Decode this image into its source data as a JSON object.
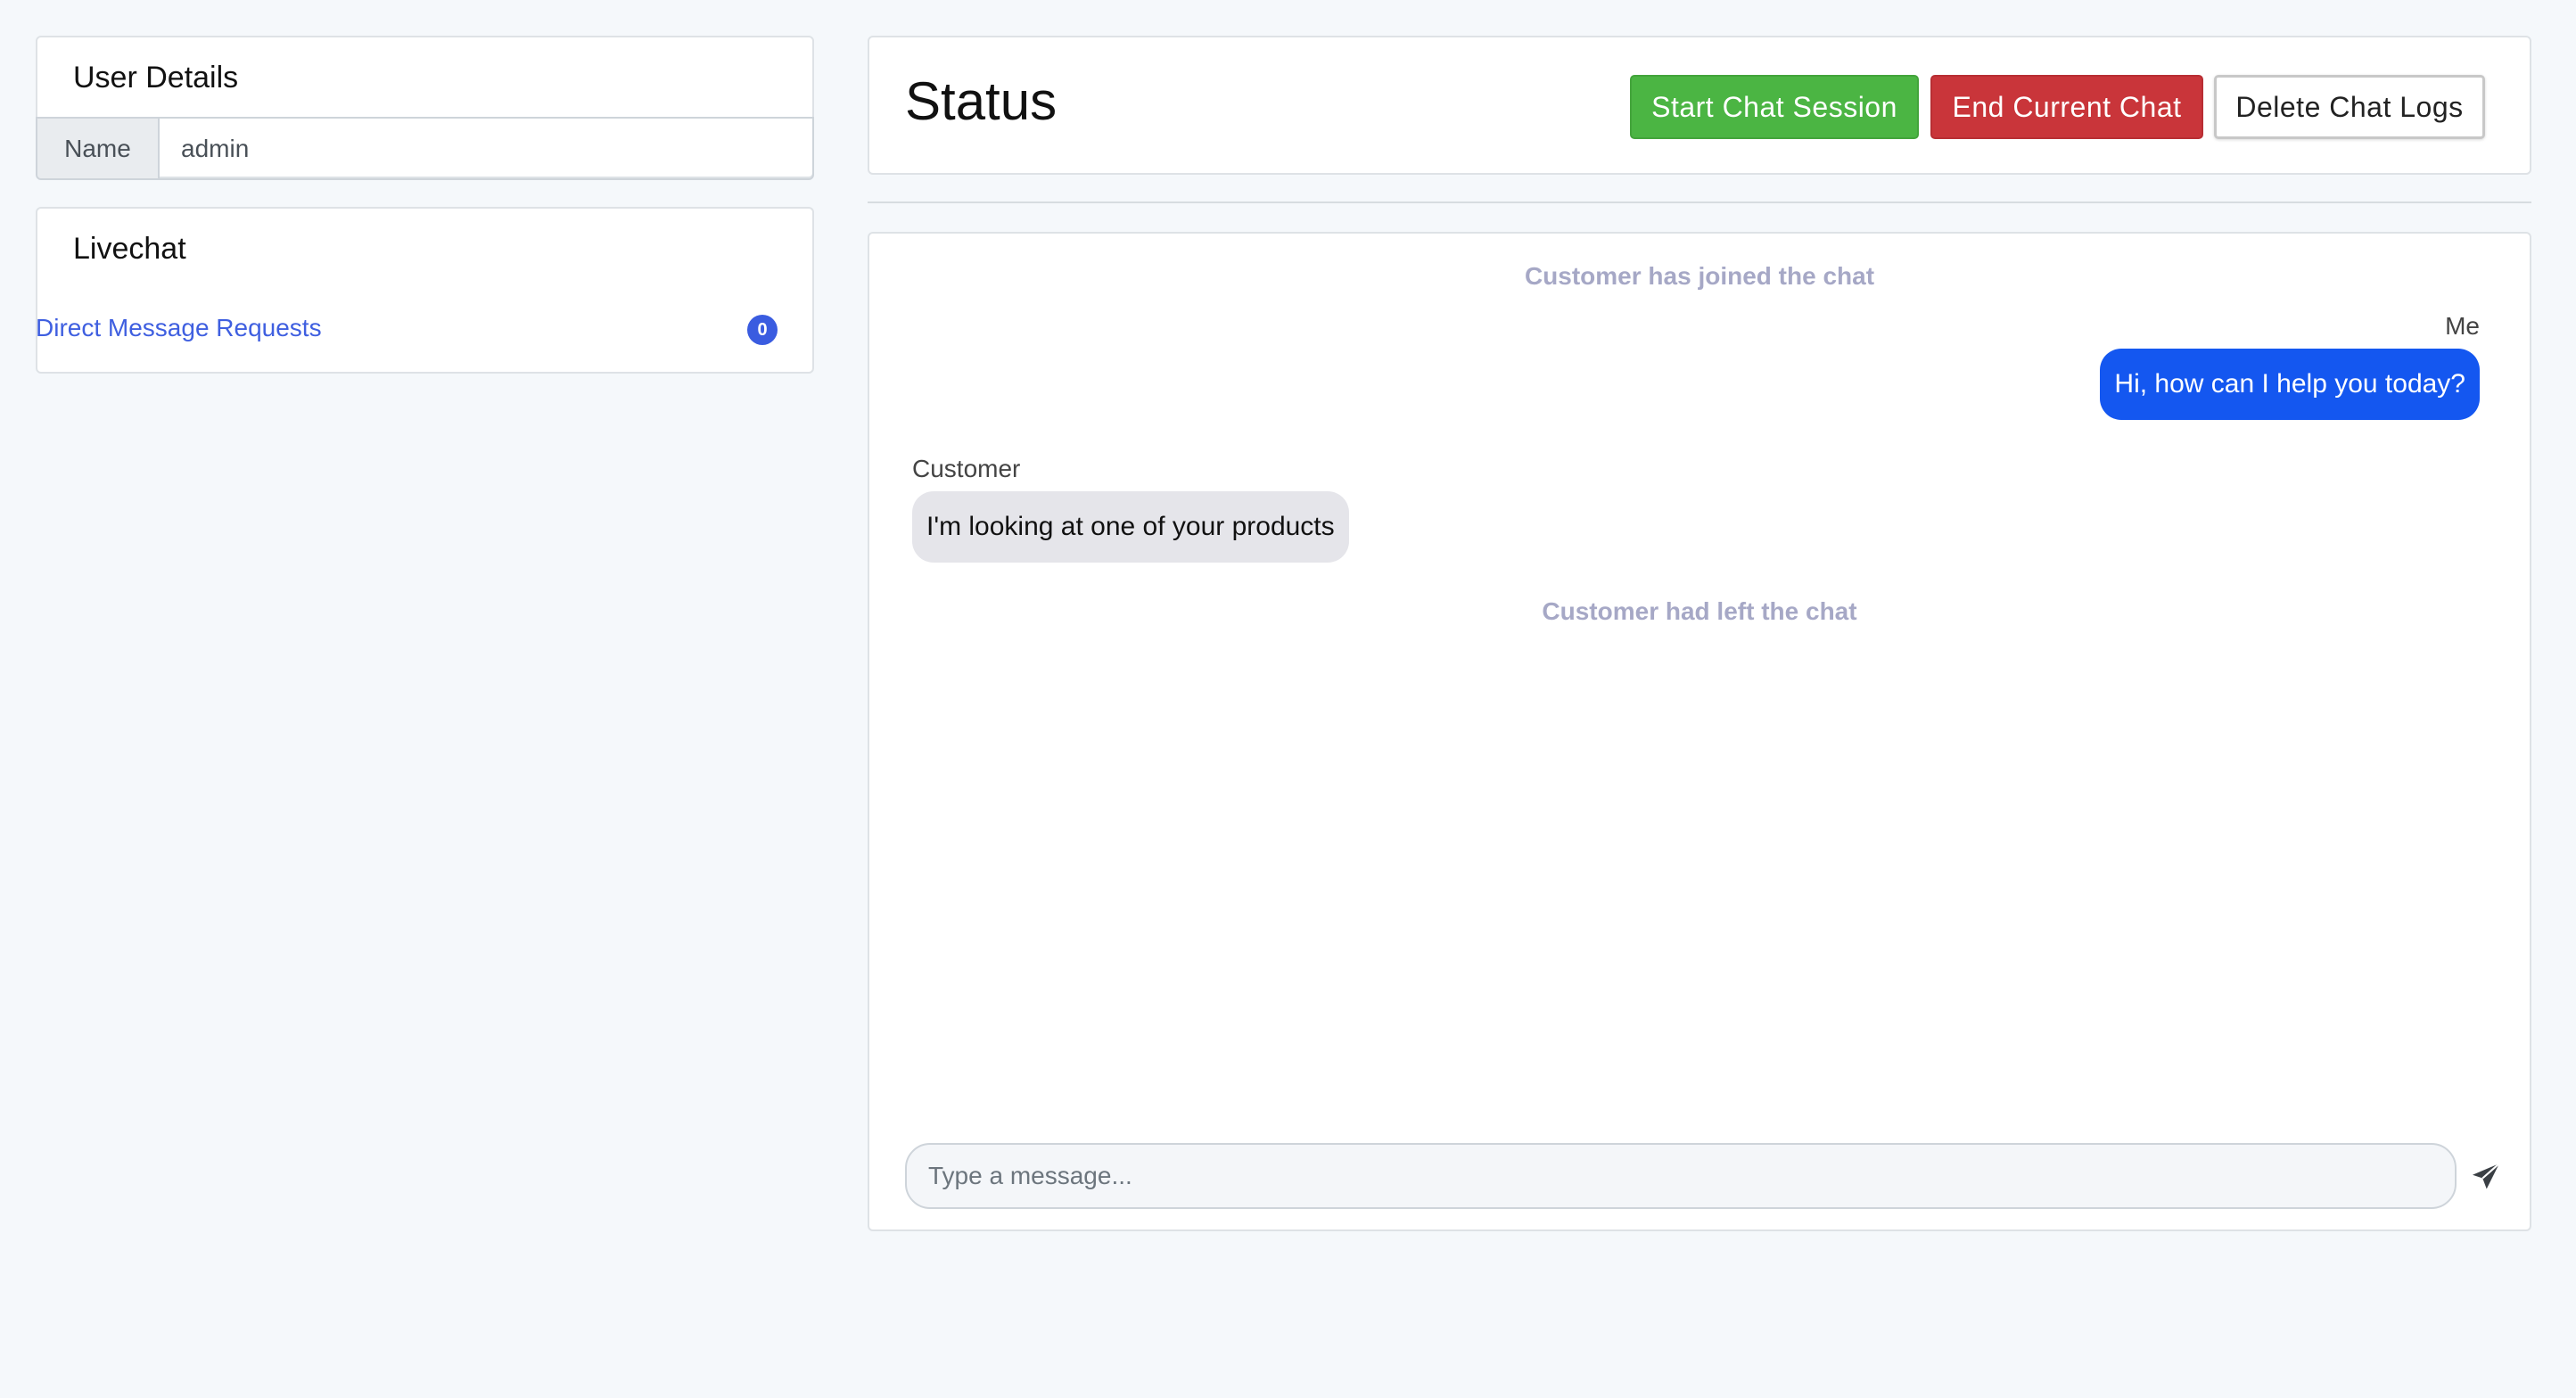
{
  "user_details": {
    "title": "User Details",
    "name_label": "Name",
    "name_value": "admin"
  },
  "livechat": {
    "title": "Livechat",
    "dm_requests_label": "Direct Message Requests",
    "dm_requests_count": "0"
  },
  "status": {
    "title": "Status",
    "start_button": "Start Chat Session",
    "end_button": "End Current Chat",
    "delete_button": "Delete Chat Logs"
  },
  "chat": {
    "system_joined": "Customer has joined the chat",
    "me_label": "Me",
    "me_message": "Hi, how can I help you today?",
    "customer_label": "Customer",
    "customer_message": "I'm looking at one of your products",
    "system_left": "Customer had left the chat",
    "input_placeholder": "Type a message...",
    "send_icon": "send-icon"
  },
  "colors": {
    "start_button": "#4bb543",
    "end_button": "#c9353a",
    "my_bubble": "#1457f0",
    "customer_bubble": "#e5e5ea",
    "link": "#3f5fe0",
    "badge": "#3a5ce0",
    "system_text": "#a6a8c6"
  }
}
